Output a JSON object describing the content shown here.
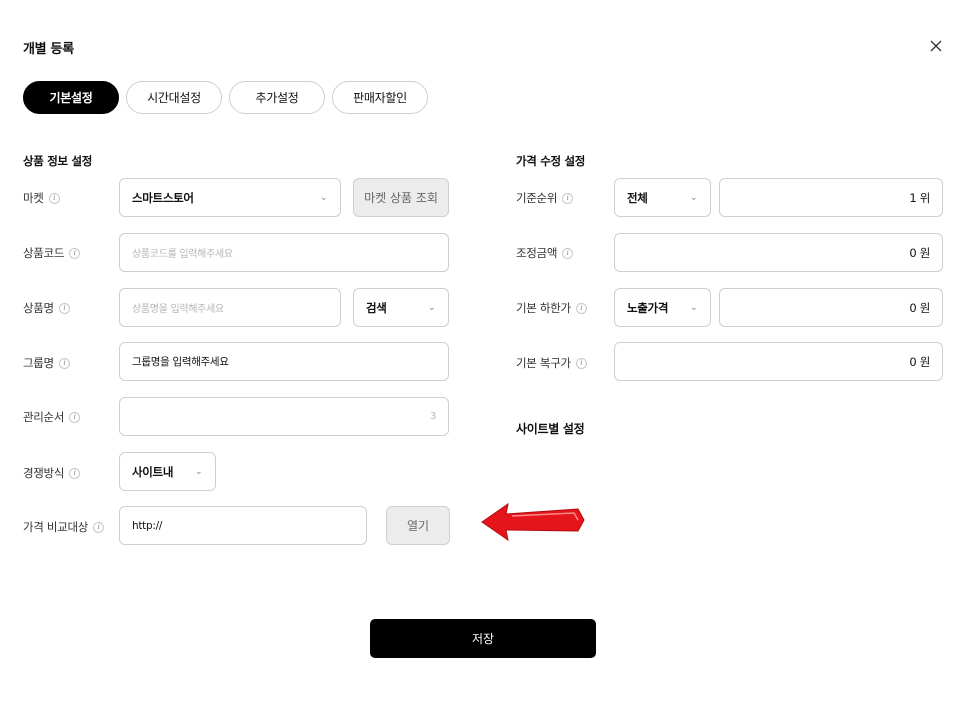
{
  "modal": {
    "title": "개별 등록"
  },
  "tabs": [
    {
      "label": "기본설정",
      "active": true
    },
    {
      "label": "시간대설정",
      "active": false
    },
    {
      "label": "추가설정",
      "active": false
    },
    {
      "label": "판매자할인",
      "active": false
    }
  ],
  "product": {
    "section_title": "상품 정보 설정",
    "market_label": "마켓",
    "market_value": "스마트스토어",
    "market_lookup_button": "마켓 상품 조회",
    "code_label": "상품코드",
    "code_placeholder": "상품코드를 입력해주세요",
    "name_label": "상품명",
    "name_placeholder": "상품명을 입력해주세요",
    "name_search_value": "검색",
    "group_label": "그룹명",
    "group_value": "그룹명을 입력해주세요",
    "order_label": "관리순서",
    "order_value": "3",
    "competition_label": "경쟁방식",
    "competition_value": "사이트내",
    "compare_label": "가격 비교대상",
    "compare_value": "http://",
    "open_button": "열기"
  },
  "price": {
    "section_title": "가격 수정 설정",
    "rank_label": "기준순위",
    "rank_select": "전체",
    "rank_value": "1 위",
    "adjust_label": "조정금액",
    "adjust_value": "0 원",
    "lower_label": "기본 하한가",
    "lower_select": "노출가격",
    "lower_value": "0 원",
    "restore_label": "기본 복구가",
    "restore_value": "0 원",
    "site_section_title": "사이트별 설정"
  },
  "footer": {
    "save_label": "저장"
  },
  "colors": {
    "accent": "#000000",
    "arrow": "#e5151b",
    "border": "#cfcfcf"
  },
  "icons": {
    "info": "info-icon",
    "close": "close-icon",
    "chevron": "chevron-down-icon",
    "arrow": "arrow-left-icon"
  }
}
